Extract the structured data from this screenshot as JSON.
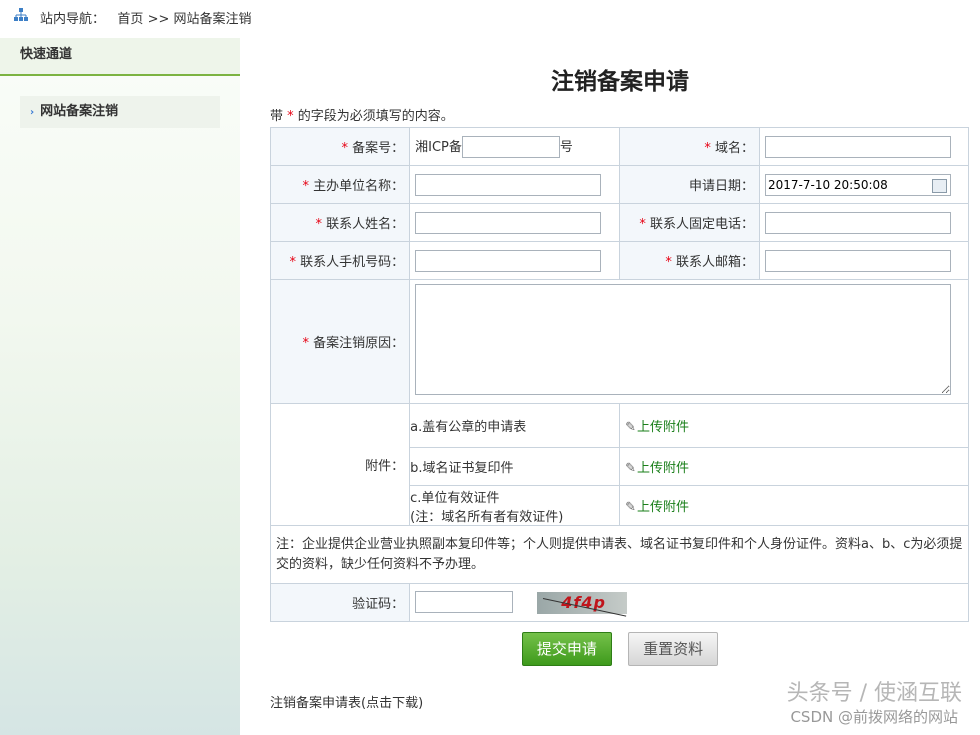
{
  "topnav": {
    "label": "站内导航：",
    "home": "首页",
    "sep": ">>",
    "current": "网站备案注销"
  },
  "sidebar": {
    "header": "快速通道",
    "items": [
      {
        "label": "网站备案注销"
      }
    ]
  },
  "form": {
    "title": "注销备案申请",
    "note_prefix": "带",
    "note_star": "*",
    "note_suffix": "的字段为必须填写的内容。",
    "star": "*",
    "fields": {
      "beian_no": {
        "label": "备案号：",
        "prefix": "湘ICP备",
        "suffix": "号",
        "value": ""
      },
      "domain": {
        "label": "域名：",
        "value": ""
      },
      "org_name": {
        "label": "主办单位名称：",
        "value": ""
      },
      "apply_date": {
        "label": "申请日期：",
        "value": "2017-7-10 20:50:08"
      },
      "contact_name": {
        "label": "联系人姓名：",
        "value": ""
      },
      "contact_tel": {
        "label": "联系人固定电话：",
        "value": ""
      },
      "contact_mobile": {
        "label": "联系人手机号码：",
        "value": ""
      },
      "contact_email": {
        "label": "联系人邮箱：",
        "value": ""
      },
      "reason": {
        "label": "备案注销原因：",
        "value": ""
      }
    },
    "attachments": {
      "label": "附件：",
      "upload_label": "上传附件",
      "items": [
        {
          "name": "a.盖有公章的申请表"
        },
        {
          "name": "b.域名证书复印件"
        },
        {
          "name": "c.单位有效证件",
          "sub": "(注：域名所有者有效证件)"
        }
      ]
    },
    "remark": "注：企业提供企业营业执照副本复印件等；个人则提供申请表、域名证书复印件和个人身份证件。资料a、b、c为必须提交的资料，缺少任何资料不予办理。",
    "captcha": {
      "label": "验证码：",
      "value": "",
      "image_text": "4f4p"
    },
    "buttons": {
      "submit": "提交申请",
      "reset": "重置资料"
    },
    "download": "注销备案申请表(点击下载)"
  },
  "watermark": {
    "text": "头条号 / 使涵互联",
    "csdn": "CSDN @前拨网络的网站"
  }
}
